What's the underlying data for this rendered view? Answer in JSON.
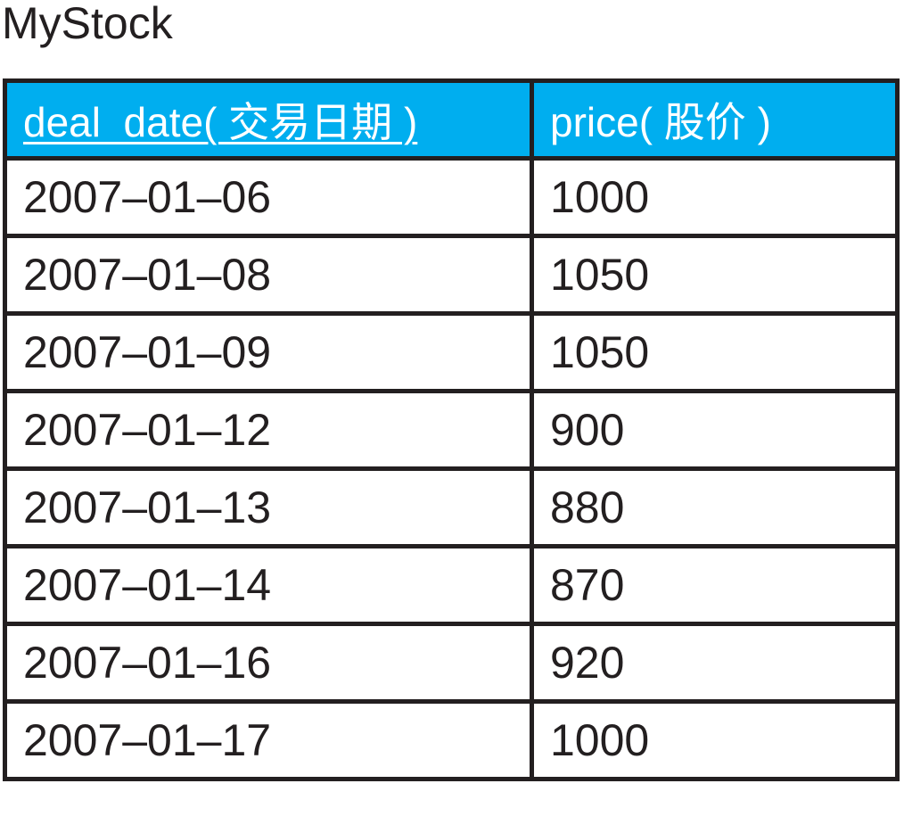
{
  "table": {
    "name": "MyStock",
    "columns": [
      {
        "label": "deal_date( 交易日期 )",
        "primary_key": true
      },
      {
        "label": "price( 股价 )",
        "primary_key": false
      }
    ],
    "rows": [
      {
        "deal_date": "2007–01–06",
        "price": "1000"
      },
      {
        "deal_date": "2007–01–08",
        "price": "1050"
      },
      {
        "deal_date": "2007–01–09",
        "price": "1050"
      },
      {
        "deal_date": "2007–01–12",
        "price": "900"
      },
      {
        "deal_date": "2007–01–13",
        "price": "880"
      },
      {
        "deal_date": "2007–01–14",
        "price": "870"
      },
      {
        "deal_date": "2007–01–16",
        "price": "920"
      },
      {
        "deal_date": "2007–01–17",
        "price": "1000"
      }
    ]
  },
  "colors": {
    "header_background": "#00aeef",
    "header_text": "#ffffff",
    "border": "#231f20",
    "text": "#231f20"
  }
}
